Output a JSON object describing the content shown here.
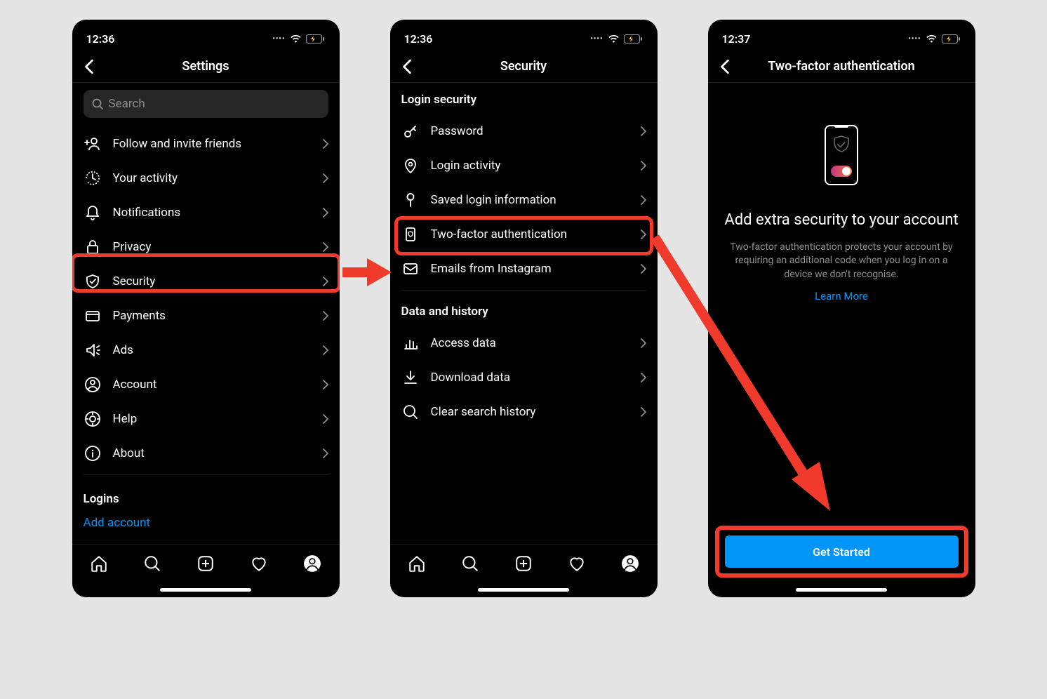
{
  "time_a": "12:36",
  "time_b": "12:37",
  "screen1": {
    "title": "Settings",
    "search_placeholder": "Search",
    "items": [
      {
        "label": "Follow and invite friends"
      },
      {
        "label": "Your activity"
      },
      {
        "label": "Notifications"
      },
      {
        "label": "Privacy"
      },
      {
        "label": "Security"
      },
      {
        "label": "Payments"
      },
      {
        "label": "Ads"
      },
      {
        "label": "Account"
      },
      {
        "label": "Help"
      },
      {
        "label": "About"
      }
    ],
    "logins_header": "Logins",
    "add_account": "Add account"
  },
  "screen2": {
    "title": "Security",
    "section_a": "Login security",
    "section_b": "Data and history",
    "items_a": [
      {
        "label": "Password"
      },
      {
        "label": "Login activity"
      },
      {
        "label": "Saved login information"
      },
      {
        "label": "Two-factor authentication"
      },
      {
        "label": "Emails from Instagram"
      }
    ],
    "items_b": [
      {
        "label": "Access data"
      },
      {
        "label": "Download data"
      },
      {
        "label": "Clear search history"
      }
    ]
  },
  "screen3": {
    "title": "Two-factor authentication",
    "heading": "Add extra security to your account",
    "description": "Two-factor authentication protects your account by requiring an additional code when you log in on a device we don't recognise.",
    "learn_more": "Learn More",
    "cta": "Get Started"
  }
}
